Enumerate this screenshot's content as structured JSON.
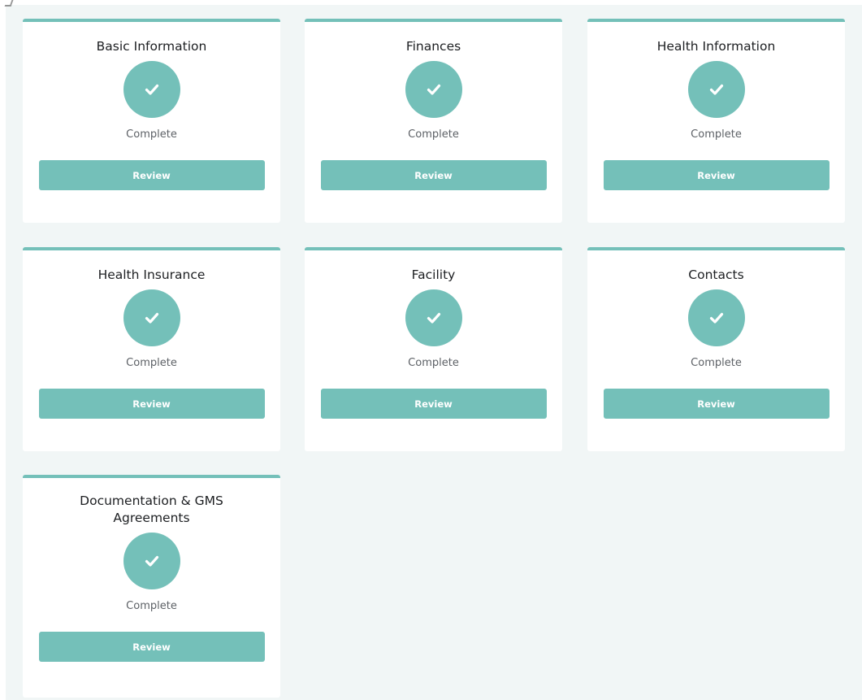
{
  "colors": {
    "accent": "#74c0b9",
    "background": "#f1f6f6",
    "card": "#ffffff",
    "title_text": "#1d1f22",
    "status_text": "#5d6166"
  },
  "cards": [
    {
      "title": "Basic Information",
      "status": "Complete",
      "button": "Review",
      "icon": "check-icon"
    },
    {
      "title": "Finances",
      "status": "Complete",
      "button": "Review",
      "icon": "check-icon"
    },
    {
      "title": "Health Information",
      "status": "Complete",
      "button": "Review",
      "icon": "check-icon"
    },
    {
      "title": "Health Insurance",
      "status": "Complete",
      "button": "Review",
      "icon": "check-icon"
    },
    {
      "title": "Facility",
      "status": "Complete",
      "button": "Review",
      "icon": "check-icon"
    },
    {
      "title": "Contacts",
      "status": "Complete",
      "button": "Review",
      "icon": "check-icon"
    },
    {
      "title": "Documentation & GMS Agreements",
      "status": "Complete",
      "button": "Review",
      "icon": "check-icon"
    }
  ]
}
